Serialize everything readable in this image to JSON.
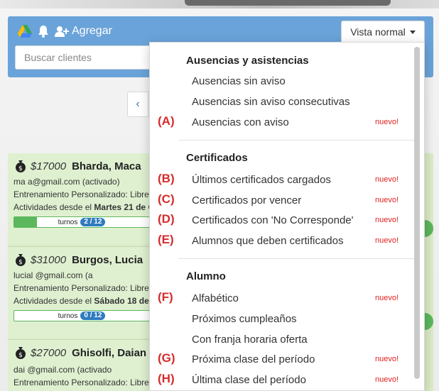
{
  "header": {
    "agregar_label": "Agregar",
    "vista_label": "Vista normal",
    "search_placeholder": "Buscar clientes"
  },
  "pager": {
    "prev_label": "‹"
  },
  "cards": [
    {
      "price": "$17000",
      "name": "Bharda, Maca",
      "email": "ma        a@gmail.com (activado)",
      "plan": "Entrenamiento Personalizado: Libre",
      "since_prefix": "Actividades desde el ",
      "since_date": "Martes 21 de C",
      "turnos_label": "turnos",
      "turnos_count": "2 / 12",
      "progress": 0.167
    },
    {
      "price": "$31000",
      "name": "Burgos, Lucia",
      "email": "lucial                   @gmail.com (a",
      "plan": "Entrenamiento Personalizado: Libre",
      "since_prefix": "Actividades desde el ",
      "since_date": "Sábado 18 de",
      "turnos_label": "turnos",
      "turnos_count": "0 / 12",
      "progress": 0
    },
    {
      "price": "$27000",
      "name": "Ghisolfi, Daian",
      "email": "dai          @gmail.com (activado",
      "plan": "Entrenamiento Personalizado: Libre"
    }
  ],
  "menu": {
    "sections": [
      {
        "title": "Ausencias y asistencias",
        "items": [
          {
            "label": "Ausencias sin aviso"
          },
          {
            "label": "Ausencias sin aviso consecutivas"
          },
          {
            "label": "Ausencias con aviso",
            "badge": "nuevo!",
            "tag": "(A)"
          }
        ]
      },
      {
        "title": "Certificados",
        "items": [
          {
            "label": "Últimos certificados cargados",
            "badge": "nuevo!",
            "tag": "(B)"
          },
          {
            "label": "Certificados por vencer",
            "badge": "nuevo!",
            "tag": "(C)"
          },
          {
            "label": "Certificados con 'No Corresponde'",
            "badge": "nuevo!",
            "tag": "(D)"
          },
          {
            "label": "Alumnos que deben certificados",
            "badge": "nuevo!",
            "tag": "(E)"
          }
        ]
      },
      {
        "title": "Alumno",
        "items": [
          {
            "label": "Alfabético",
            "badge": "nuevo!",
            "tag": "(F)"
          },
          {
            "label": "Próximos cumpleaños"
          },
          {
            "label": "Con franja horaria oferta"
          },
          {
            "label": "Próxima clase del período",
            "badge": "nuevo!",
            "tag": "(G)"
          },
          {
            "label": "Última clase del período",
            "badge": "nuevo!",
            "tag": "(H)"
          }
        ]
      }
    ]
  },
  "colors": {
    "header_bg": "#6aa3d9",
    "new_badge": "#e02020",
    "annotation": "#d62b2b",
    "progress": "#5cb85c",
    "pill": "#2f7bbf"
  }
}
